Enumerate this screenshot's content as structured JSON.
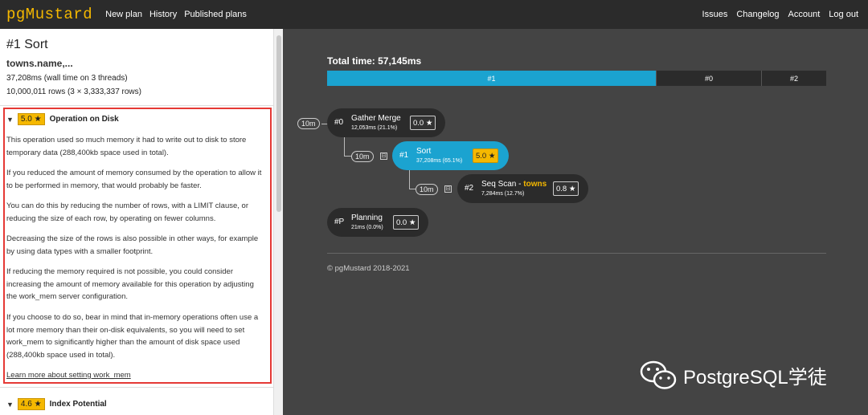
{
  "nav": {
    "logo": "pgMustard",
    "left_links": [
      "New plan",
      "History",
      "Published plans"
    ],
    "right_links": [
      "Issues",
      "Changelog",
      "Account",
      "Log out"
    ]
  },
  "details": {
    "title": "#1 Sort",
    "subtitle": "towns.name,...",
    "time_line": "37,208ms (wall time on 3 threads)",
    "rows_line": "10,000,011 rows (3 × 3,333,337 rows)"
  },
  "tip": {
    "score": "5.0 ★",
    "name": "Operation on Disk",
    "paragraphs": [
      "This operation used so much memory it had to write out to disk to store temporary data (288,400kb space used in total).",
      "If you reduced the amount of memory consumed by the operation to allow it to be performed in memory, that would probably be faster.",
      "You can do this by reducing the number of rows, with a LIMIT clause, or reducing the size of each row, by operating on fewer columns.",
      "Decreasing the size of the rows is also possible in other ways, for example by using data types with a smaller footprint.",
      "If reducing the memory required is not possible, you could consider increasing the amount of memory available for this operation by adjusting the work_mem server configuration.",
      "If you choose to do so, bear in mind that in-memory operations often use a lot more memory than their on-disk equivalents, so you will need to set work_mem to significantly higher than the amount of disk space used (288,400kb space used in total)."
    ],
    "link": "Learn more about setting work_mem"
  },
  "tip2": {
    "score": "4.6 ★",
    "name": "Index Potential"
  },
  "timing": {
    "label": "Total time: 57,145ms",
    "segments": [
      {
        "label": "#1",
        "share": 0.651
      },
      {
        "label": "#0",
        "share": 0.211
      },
      {
        "label": "#2",
        "share": 0.127
      }
    ]
  },
  "nodes": [
    {
      "id": "#0",
      "name": "Gather Merge",
      "relation": "",
      "time": "12,053ms (21.1%)",
      "score": "0.0 ★",
      "rows": "10m"
    },
    {
      "id": "#1",
      "name": "Sort",
      "relation": "",
      "time": "37,208ms (65.1%)",
      "score": "5.0 ★",
      "rows": "10m"
    },
    {
      "id": "#2",
      "name": "Seq Scan - ",
      "relation": "towns",
      "time": "7,284ms (12.7%)",
      "score": "0.8 ★",
      "rows": "10m"
    },
    {
      "id": "#P",
      "name": "Planning",
      "relation": "",
      "time": "21ms (0.0%)",
      "score": "0.0 ★",
      "rows": ""
    }
  ],
  "collapse_symbol": "⊟",
  "footer": {
    "copyright": "© pgMustard 2018-2021"
  },
  "watermark": {
    "text": "PostgreSQL学徒"
  },
  "colors": {
    "accent": "#1ba3d0",
    "brand": "#f5b800",
    "highlight_border": "#e53935"
  }
}
